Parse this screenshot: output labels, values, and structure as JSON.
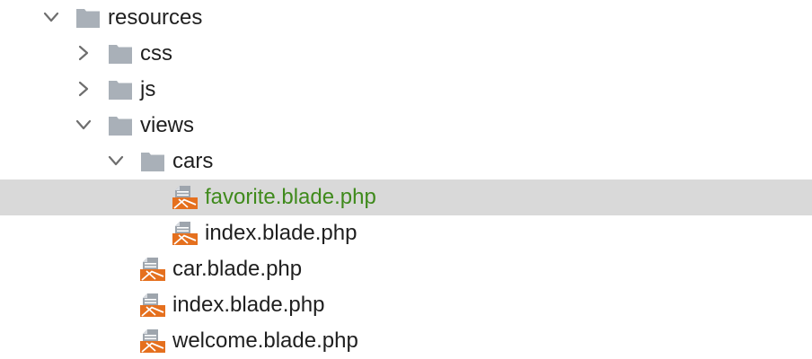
{
  "colors": {
    "folder": "#a9b0b8",
    "blade_orange": "#e5701e",
    "blade_doc": "#9ea5ad",
    "chevron": "#6e6e6e",
    "selection": "#d9d9d9",
    "selected_text": "#3f8a1c",
    "text": "#1f1f1f"
  },
  "tree": {
    "resources": {
      "label": "resources",
      "state": "expanded",
      "icon": "folder-icon"
    },
    "css": {
      "label": "css",
      "state": "collapsed",
      "icon": "folder-icon"
    },
    "js": {
      "label": "js",
      "state": "collapsed",
      "icon": "folder-icon"
    },
    "views": {
      "label": "views",
      "state": "expanded",
      "icon": "folder-icon"
    },
    "cars": {
      "label": "cars",
      "state": "expanded",
      "icon": "folder-icon"
    },
    "favorite": {
      "label": "favorite.blade.php",
      "selected": true,
      "icon": "blade-file-icon"
    },
    "cars_index": {
      "label": "index.blade.php",
      "icon": "blade-file-icon"
    },
    "car": {
      "label": "car.blade.php",
      "icon": "blade-file-icon"
    },
    "views_index": {
      "label": "index.blade.php",
      "icon": "blade-file-icon"
    },
    "welcome": {
      "label": "welcome.blade.php",
      "icon": "blade-file-icon"
    }
  }
}
